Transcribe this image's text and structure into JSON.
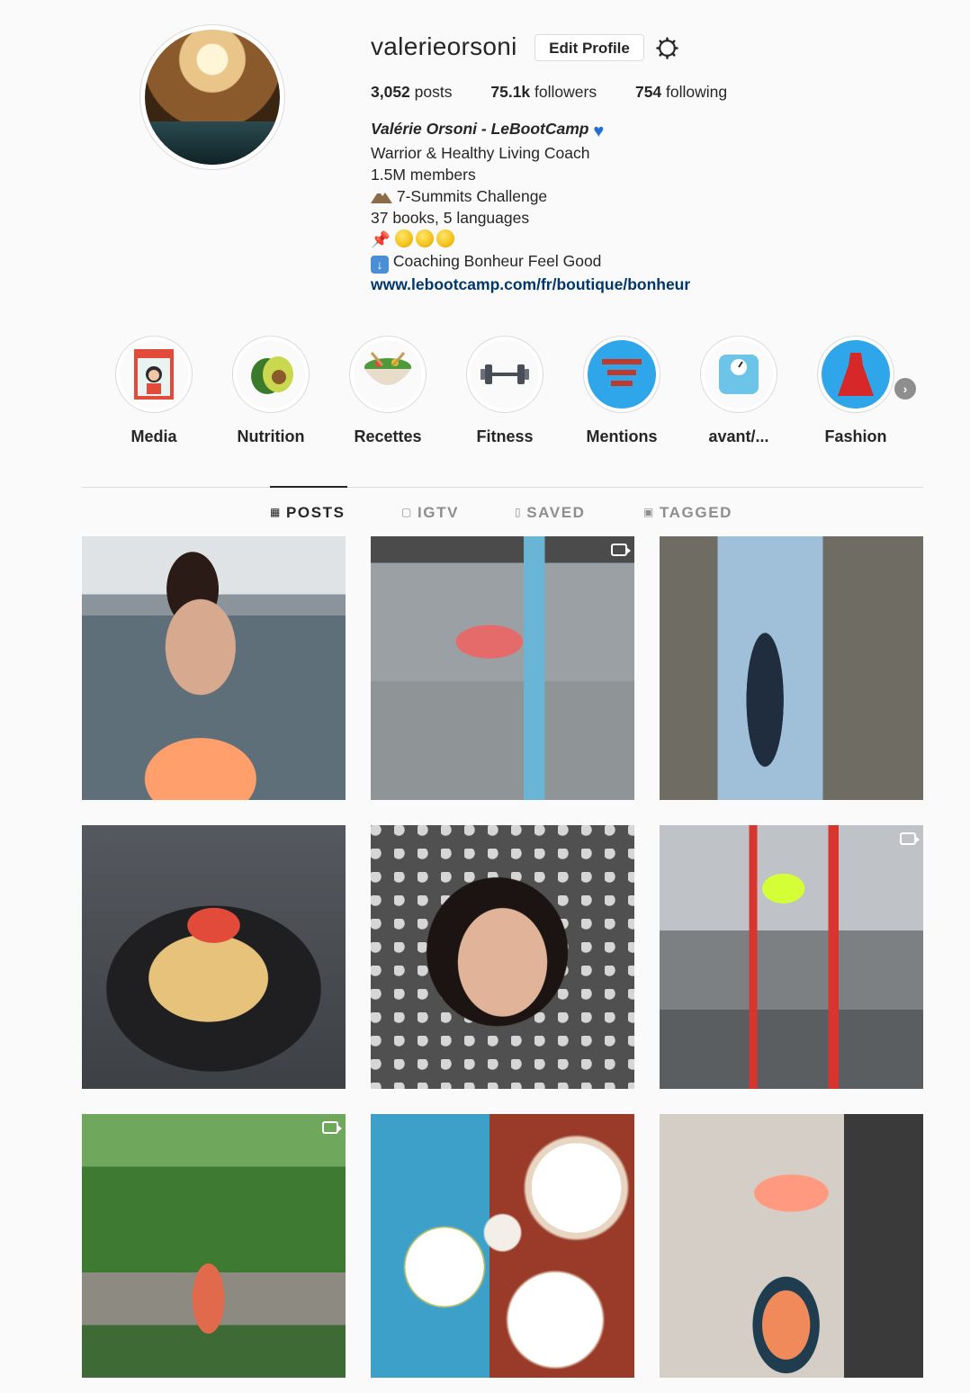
{
  "profile": {
    "username": "valerieorsoni",
    "edit_label": "Edit Profile",
    "stats": {
      "posts_count": "3,052",
      "posts_label": " posts",
      "followers_count": "75.1k",
      "followers_label": " followers",
      "following_count": "754",
      "following_label": " following"
    },
    "bio": {
      "name": "Valérie Orsoni - LeBootCamp",
      "line1": "Warrior & Healthy Living Coach",
      "line2": "1.5M members",
      "line3": "7-Summits Challenge",
      "line4": "37 books, 5 languages",
      "line6": "Coaching Bonheur Feel Good",
      "link": "www.lebootcamp.com/fr/boutique/bonheur"
    }
  },
  "highlights": [
    {
      "label": "Media",
      "icon": "magazine-icon"
    },
    {
      "label": "Nutrition",
      "icon": "avocado-icon"
    },
    {
      "label": "Recettes",
      "icon": "salad-bowl-icon"
    },
    {
      "label": "Fitness",
      "icon": "dumbbell-icon"
    },
    {
      "label": "Mentions",
      "icon": "thank-you-icon"
    },
    {
      "label": "avant/...",
      "icon": "scale-icon"
    },
    {
      "label": "Fashion",
      "icon": "dress-icon"
    }
  ],
  "tabs": [
    {
      "label": "POSTS",
      "active": true
    },
    {
      "label": "IGTV",
      "active": false
    },
    {
      "label": "SAVED",
      "active": false
    },
    {
      "label": "TAGGED",
      "active": false
    }
  ],
  "colors": {
    "link": "#00376b",
    "background": "#fafafa",
    "border": "#dbdbdb"
  }
}
